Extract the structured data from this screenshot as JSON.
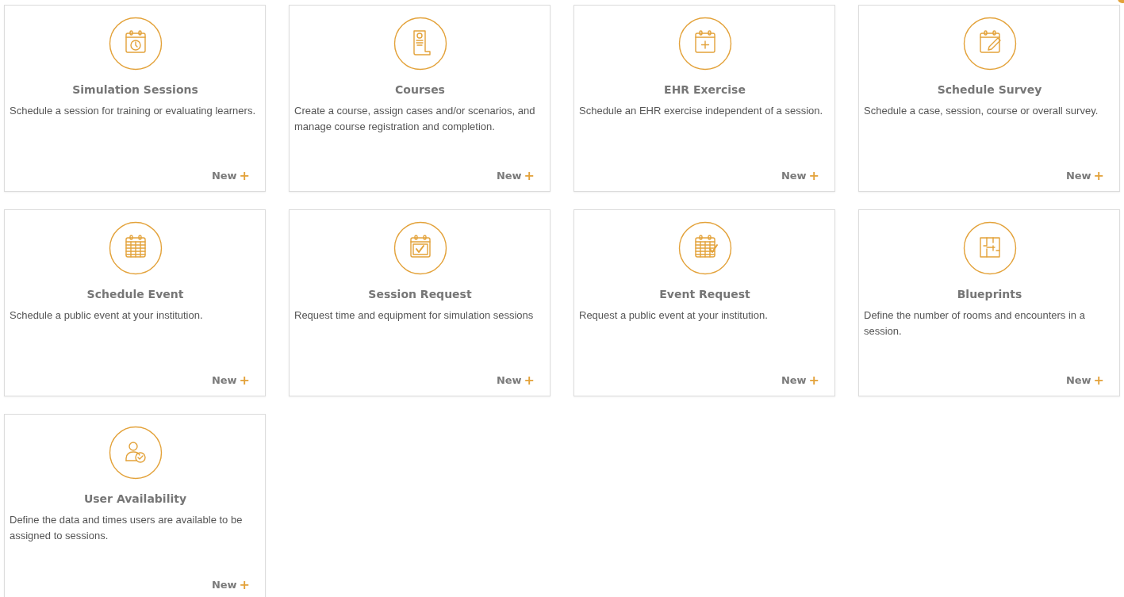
{
  "cards": [
    {
      "kind": "calendar-clock",
      "title": "Simulation Sessions",
      "description": "Schedule a session for training or evaluating learners.",
      "action": "New",
      "action_icon": "+"
    },
    {
      "kind": "scroll",
      "title": "Courses",
      "description": "Create a course, assign cases and/or scenarios, and manage course registration and completion.",
      "action": "New",
      "action_icon": "+"
    },
    {
      "kind": "calendar-plus",
      "title": "EHR Exercise",
      "description": "Schedule an EHR exercise independent of a session.",
      "action": "New",
      "action_icon": "+"
    },
    {
      "kind": "calendar-pencil",
      "title": "Schedule Survey",
      "description": "Schedule a case, session, course or overall survey.",
      "action": "New",
      "action_icon": "+"
    },
    {
      "kind": "calendar-grid",
      "title": "Schedule Event",
      "description": "Schedule a public event at your institution.",
      "action": "New",
      "action_icon": "+"
    },
    {
      "kind": "calendar-check",
      "title": "Session Request",
      "description": "Request time and equipment for simulation sessions",
      "action": "New",
      "action_icon": "+"
    },
    {
      "kind": "calendar-grid-check",
      "title": "Event Request",
      "description": "Request a public event at your institution.",
      "action": "New",
      "action_icon": "+"
    },
    {
      "kind": "floor-plan",
      "title": "Blueprints",
      "description": "Define the number of rooms and encounters in a session.",
      "action": "New",
      "action_icon": "+"
    },
    {
      "kind": "user-check",
      "title": "User Availability",
      "description": "Define the data and times users are available to be assigned to sessions.",
      "action": "New",
      "action_icon": "+"
    }
  ]
}
